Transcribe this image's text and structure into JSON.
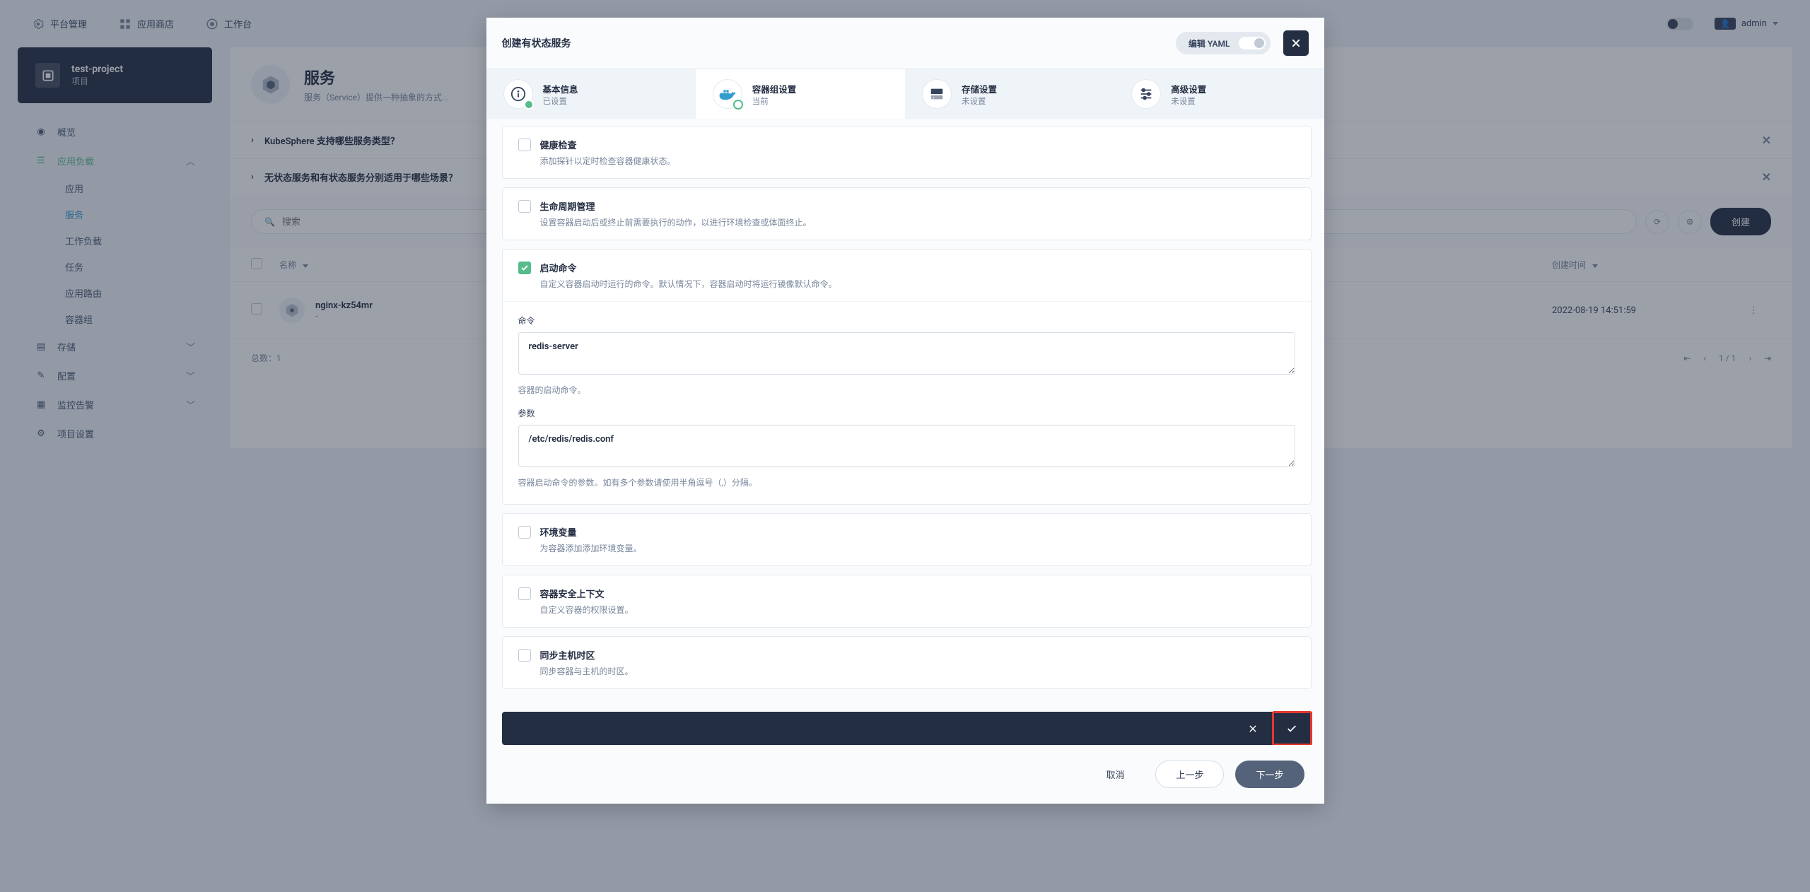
{
  "topbar": {
    "platform": "平台管理",
    "appstore": "应用商店",
    "workbench": "工作台",
    "user": "admin"
  },
  "project": {
    "name": "test-project",
    "sub": "项目"
  },
  "sidebar": {
    "overview": "概览",
    "workload_group": "应用负载",
    "items": {
      "app": "应用",
      "service": "服务",
      "workload": "工作负载",
      "job": "任务",
      "route": "应用路由",
      "pod": "容器组"
    },
    "storage": "存储",
    "config": "配置",
    "monitor": "监控告警",
    "settings": "项目设置"
  },
  "page": {
    "title": "服务",
    "subtitle": "服务（Service）提供一种抽象的方式...",
    "q1": "KubeSphere 支持哪些服务类型？",
    "q2": "无状态服务和有状态服务分别适用于哪些场景？"
  },
  "toolbar": {
    "search_ph": "搜索",
    "create": "创建"
  },
  "table": {
    "col_name": "名称",
    "col_time": "创建时间",
    "row_name": "nginx-kz54mr",
    "row_sub": "-",
    "row_time": "2022-08-19 14:51:59",
    "total": "总数：1",
    "page": "1 / 1"
  },
  "modal": {
    "title": "创建有状态服务",
    "yaml": "编辑 YAML",
    "steps": {
      "s1_t": "基本信息",
      "s1_s": "已设置",
      "s2_t": "容器组设置",
      "s2_s": "当前",
      "s3_t": "存储设置",
      "s3_s": "未设置",
      "s4_t": "高级设置",
      "s4_s": "未设置"
    },
    "cards": {
      "health_t": "健康检查",
      "health_d": "添加探针以定时检查容器健康状态。",
      "life_t": "生命周期管理",
      "life_d": "设置容器启动后或终止前需要执行的动作，以进行环境检查或体面终止。",
      "start_t": "启动命令",
      "start_d": "自定义容器启动时运行的命令。默认情况下，容器启动时将运行镜像默认命令。",
      "cmd_label": "命令",
      "cmd_value": "redis-server",
      "cmd_help": "容器的启动命令。",
      "arg_label": "参数",
      "arg_value": "/etc/redis/redis.conf",
      "arg_help": "容器启动命令的参数。如有多个参数请使用半角逗号（,）分隔。",
      "env_t": "环境变量",
      "env_d": "为容器添加添加环境变量。",
      "sec_t": "容器安全上下文",
      "sec_d": "自定义容器的权限设置。",
      "tz_t": "同步主机时区",
      "tz_d": "同步容器与主机的时区。"
    },
    "footer": {
      "cancel": "取消",
      "prev": "上一步",
      "next": "下一步"
    }
  }
}
